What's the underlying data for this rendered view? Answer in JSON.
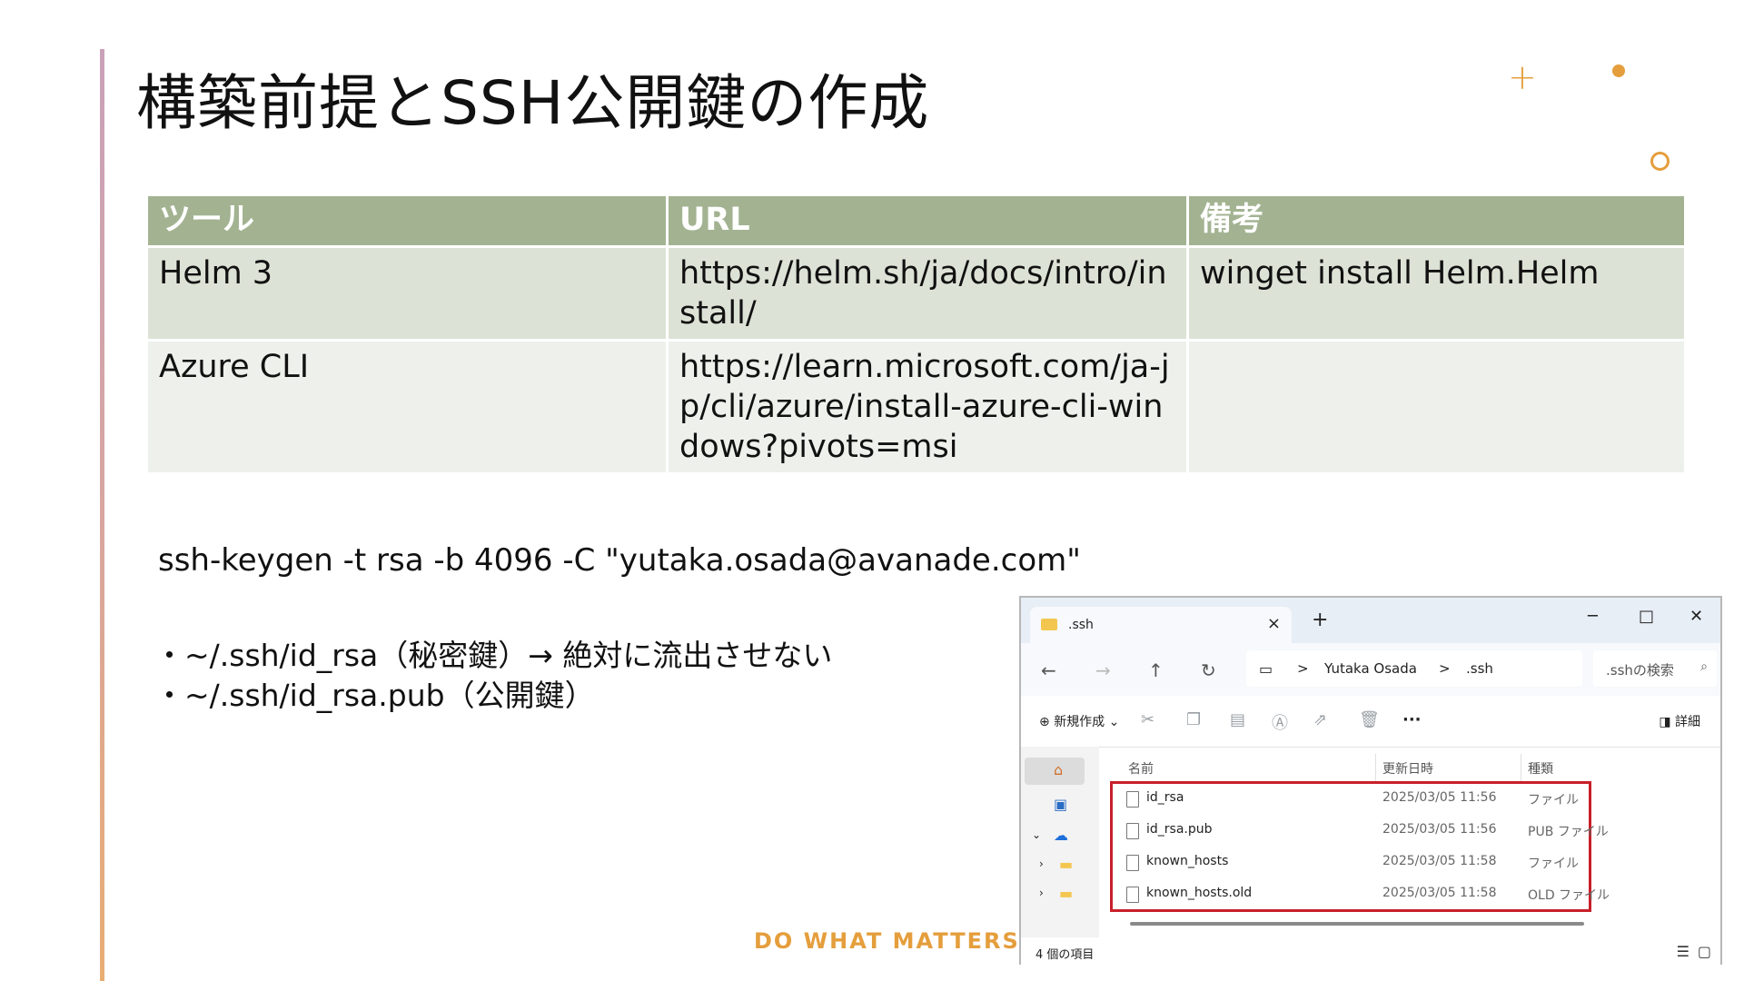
{
  "slide": {
    "title": "構築前提とSSH公開鍵の作成",
    "decorations": {
      "plus": "+",
      "accent_color": "#e59e3c"
    },
    "table": {
      "headers": [
        "ツール",
        "URL",
        "備考"
      ],
      "rows": [
        [
          "Helm 3",
          "https://helm.sh/ja/docs/intro/install/",
          "winget install Helm.Helm"
        ],
        [
          "Azure CLI",
          "https://learn.microsoft.com/ja-jp/cli/azure/install-azure-cli-windows?pivots=msi",
          ""
        ]
      ],
      "header_color": "#a3b392"
    },
    "command": "ssh-keygen -t rsa -b 4096 -C \"yutaka.osada@avanade.com\"",
    "bullets": [
      "・~/.ssh/id_rsa（秘密鍵）→ 絶対に流出させない",
      "・~/.ssh/id_rsa.pub（公開鍵）"
    ],
    "footer": "DO WHAT MATTERS"
  },
  "explorer": {
    "tab_title": ".ssh",
    "tab_close": "×",
    "new_tab": "+",
    "window_buttons": {
      "minimize": "─",
      "maximize": "□",
      "close": "✕"
    },
    "nav": {
      "back": "←",
      "forward": "→",
      "up": "↑",
      "refresh": "↻"
    },
    "breadcrumb": [
      "Yutaka Osada",
      ".ssh"
    ],
    "breadcrumb_sep": ">",
    "search_placeholder": ".sshの検索",
    "toolbar": {
      "new_label": "新規作成",
      "details_label": "詳細",
      "more": "···"
    },
    "columns": {
      "name": "名前",
      "modified": "更新日時",
      "type": "種類"
    },
    "files": [
      {
        "name": "id_rsa",
        "modified": "2025/03/05 11:56",
        "type": "ファイル"
      },
      {
        "name": "id_rsa.pub",
        "modified": "2025/03/05 11:56",
        "type": "PUB ファイル"
      },
      {
        "name": "known_hosts",
        "modified": "2025/03/05 11:58",
        "type": "ファイル"
      },
      {
        "name": "known_hosts.old",
        "modified": "2025/03/05 11:58",
        "type": "OLD ファイル"
      }
    ],
    "status": "4 個の項目",
    "highlight_color": "#c8202a"
  }
}
